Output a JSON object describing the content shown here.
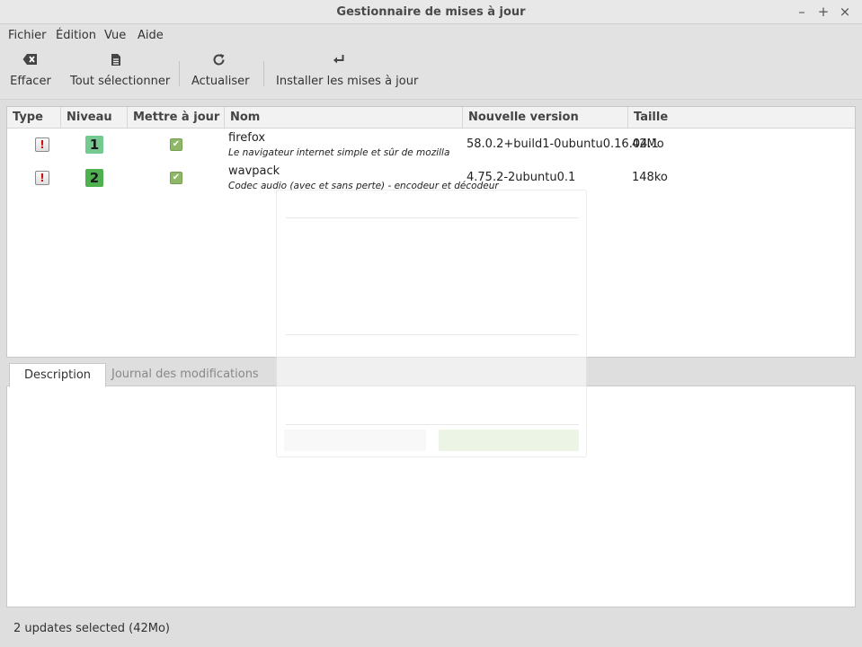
{
  "window": {
    "title": "Gestionnaire de mises à jour",
    "minimize_glyph": "–",
    "maximize_glyph": "+",
    "close_glyph": "×"
  },
  "menu": [
    "Fichier",
    "Édition",
    "Vue",
    "Aide"
  ],
  "toolbar": {
    "clear": {
      "label": "Effacer",
      "icon": "backspace-icon"
    },
    "select_all": {
      "label": "Tout sélectionner",
      "icon": "document-icon"
    },
    "refresh": {
      "label": "Actualiser",
      "icon": "refresh-icon"
    },
    "install": {
      "label": "Installer les mises à jour",
      "icon": "return-arrow-icon"
    }
  },
  "table": {
    "columns": [
      "Type",
      "Niveau",
      "Mettre à jour",
      "Nom",
      "Nouvelle version",
      "Taille"
    ],
    "rows": [
      {
        "type_glyph": "!",
        "level": "1",
        "level_color": "#73c98f",
        "checked": true,
        "name": "firefox",
        "description": "Le navigateur internet simple et sûr de mozilla",
        "new_version": "58.0.2+build1-0ubuntu0.16.04.1",
        "size": "42Mo"
      },
      {
        "type_glyph": "!",
        "level": "2",
        "level_color": "#4fb04f",
        "checked": true,
        "name": "wavpack",
        "description": "Codec audio (avec et sans perte) - encodeur et décodeur",
        "new_version": "4.75.2-2ubuntu0.1",
        "size": "148ko"
      }
    ]
  },
  "tabs": [
    "Description",
    "Journal des modifications"
  ],
  "status": "2 updates selected (42Mo)"
}
